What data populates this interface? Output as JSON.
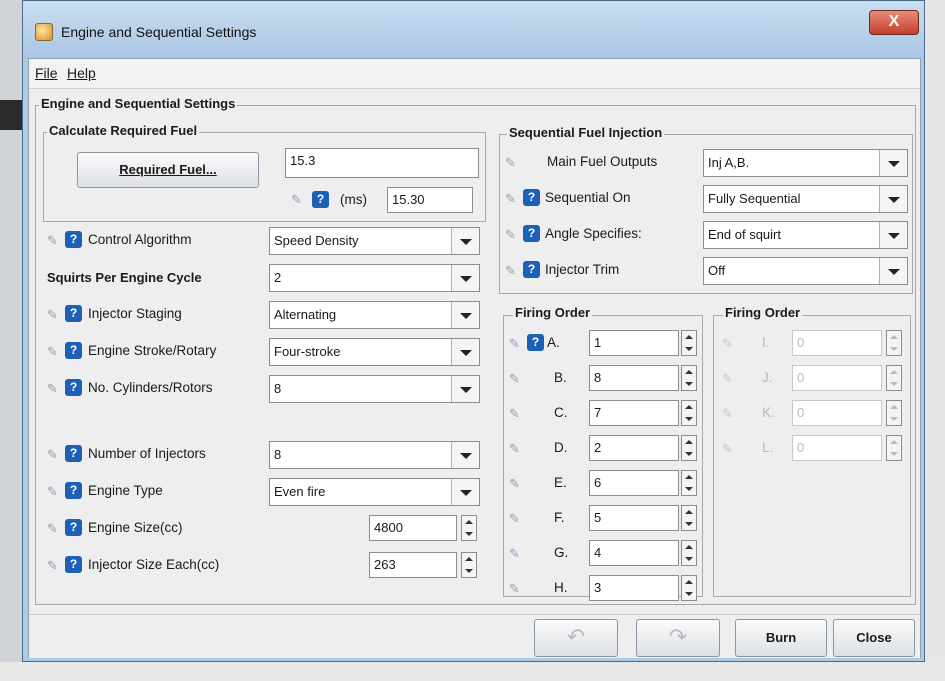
{
  "window": {
    "title": "Engine and Sequential Settings",
    "close_label": "X"
  },
  "menu": {
    "file": "File",
    "help": "Help"
  },
  "main_group": {
    "legend": "Engine and Sequential Settings"
  },
  "required_fuel": {
    "legend": "Calculate Required Fuel",
    "button_label": "Required Fuel...",
    "value": "15.3",
    "ms_label": "(ms)",
    "ms_value": "15.30"
  },
  "left_settings": [
    {
      "label": "Control Algorithm",
      "value": "Speed Density",
      "kind": "combo",
      "icons": true
    },
    {
      "label": "Squirts Per Engine Cycle",
      "value": "2",
      "kind": "combo",
      "icons": false
    },
    {
      "label": "Injector Staging",
      "value": "Alternating",
      "kind": "combo",
      "icons": true
    },
    {
      "label": "Engine Stroke/Rotary",
      "value": "Four-stroke",
      "kind": "combo",
      "icons": true
    },
    {
      "label": "No. Cylinders/Rotors",
      "value": "8",
      "kind": "combo",
      "icons": true
    },
    {
      "label": "Number of Injectors",
      "value": "8",
      "kind": "combo",
      "icons": true
    },
    {
      "label": "Engine Type",
      "value": "Even fire",
      "kind": "combo",
      "icons": true
    },
    {
      "label": "Engine Size(cc)",
      "value": "4800",
      "kind": "spinner",
      "icons": true
    },
    {
      "label": "Injector Size Each(cc)",
      "value": "263",
      "kind": "spinner",
      "icons": true
    }
  ],
  "sequential": {
    "legend": "Sequential Fuel Injection",
    "rows": [
      {
        "label": "Main Fuel Outputs",
        "value": "Inj A,B."
      },
      {
        "label": "Sequential On",
        "value": "Fully Sequential"
      },
      {
        "label": "Angle Specifies:",
        "value": "End of squirt"
      },
      {
        "label": "Injector Trim",
        "value": "Off"
      }
    ]
  },
  "firing_order_1": {
    "legend": "Firing Order",
    "rows": [
      {
        "label": "A.",
        "value": "1"
      },
      {
        "label": "B.",
        "value": "8"
      },
      {
        "label": "C.",
        "value": "7"
      },
      {
        "label": "D.",
        "value": "2"
      },
      {
        "label": "E.",
        "value": "6"
      },
      {
        "label": "F.",
        "value": "5"
      },
      {
        "label": "G.",
        "value": "4"
      },
      {
        "label": "H.",
        "value": "3"
      }
    ]
  },
  "firing_order_2": {
    "legend": "Firing Order",
    "rows": [
      {
        "label": "I.",
        "value": "0"
      },
      {
        "label": "J.",
        "value": "0"
      },
      {
        "label": "K.",
        "value": "0"
      },
      {
        "label": "L.",
        "value": "0"
      }
    ]
  },
  "bottom_buttons": {
    "burn": "Burn",
    "close": "Close"
  },
  "icons": {
    "help_glyph": "?",
    "pencil_glyph": "✎",
    "undo_glyph": "↶",
    "redo_glyph": "↷"
  }
}
